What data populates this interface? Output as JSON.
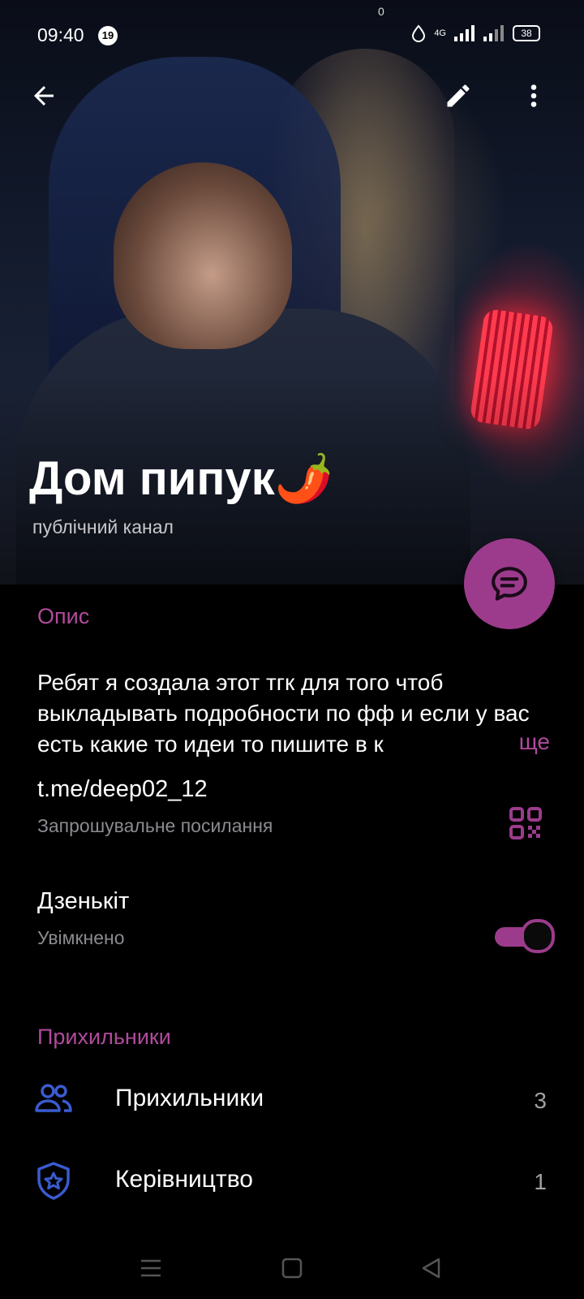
{
  "status_bar": {
    "time": "09:40",
    "notification_count": "19",
    "camera_indicator": "0",
    "network": "4G",
    "battery": "38"
  },
  "app_bar": {
    "back_icon": "arrow-left-icon",
    "edit_icon": "pencil-icon",
    "more_icon": "more-vertical-icon"
  },
  "channel": {
    "name": "Дом пипук🌶️",
    "type": "публічний канал"
  },
  "fab_icon": "chat-bubble-icon",
  "description_section": {
    "header": "Опис",
    "text": "Ребят я создала этот тгк для того чтоб выкладывать  подробности по фф и если у вас есть какие то идеи то пишите в к",
    "more_label": "ще"
  },
  "link_row": {
    "value": "t.me/deep02_12",
    "caption": "Запрошувальне посилання",
    "icon": "qr-code-icon"
  },
  "ringtone_row": {
    "title": "Дзенькіт",
    "caption": "Увімкнено",
    "enabled": true
  },
  "members_section": {
    "header": "Прихильники",
    "items": [
      {
        "label": "Прихильники",
        "count": "3",
        "icon": "users-icon"
      },
      {
        "label": "Керівництво",
        "count": "1",
        "icon": "shield-star-icon"
      }
    ]
  },
  "nav_bar": {
    "items": [
      "menu-icon",
      "home-square-icon",
      "back-triangle-icon"
    ]
  },
  "colors": {
    "accent": "#9c3b8c",
    "accent_text": "#b04a9c",
    "background": "#000000",
    "icon_blue": "#3a5bd0"
  }
}
